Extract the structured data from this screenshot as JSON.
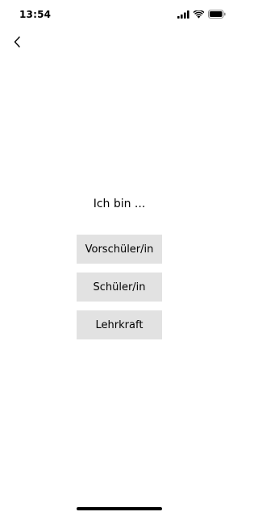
{
  "status_bar": {
    "time": "13:54",
    "icons": [
      "signal-icon",
      "wifi-icon",
      "battery-icon"
    ]
  },
  "nav": {
    "back_icon": "chevron-left-icon"
  },
  "main": {
    "prompt": "Ich bin ...",
    "options": [
      {
        "label": "Vorschüler/in"
      },
      {
        "label": "Schüler/in"
      },
      {
        "label": "Lehrkraft"
      }
    ]
  },
  "colors": {
    "background": "#ffffff",
    "button_background": "#e2e2e2",
    "text": "#000000"
  }
}
